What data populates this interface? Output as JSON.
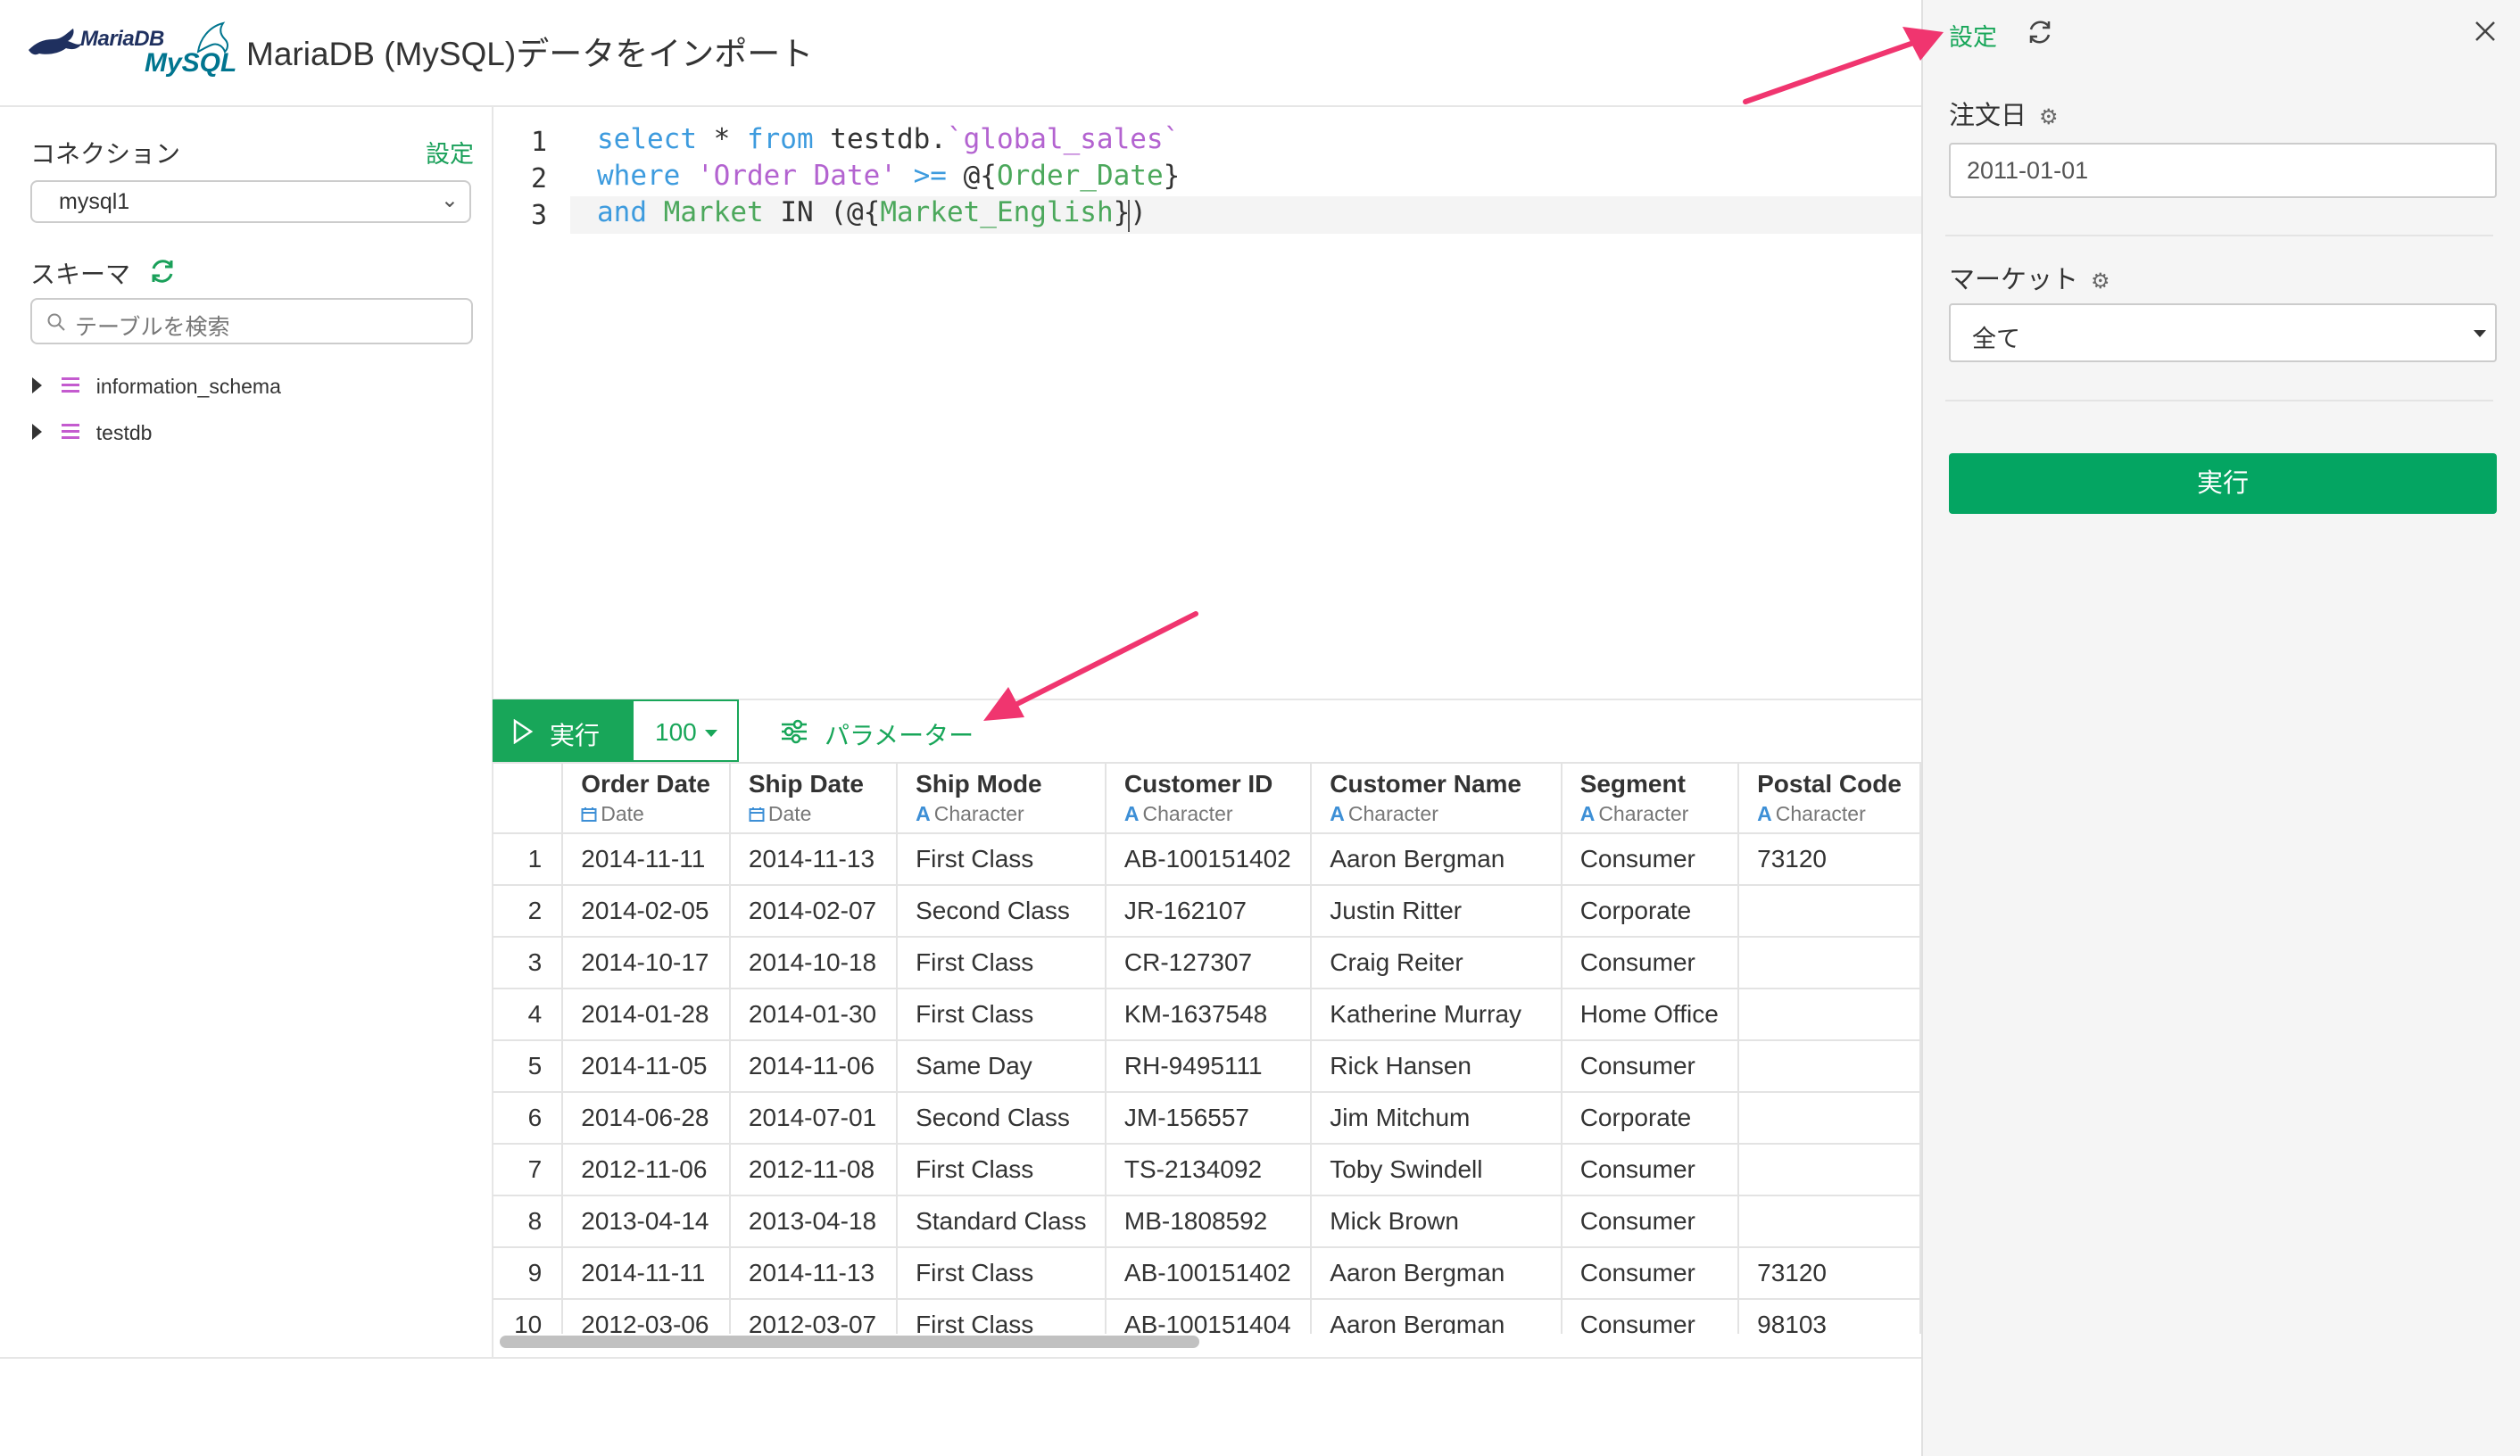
{
  "app": {
    "logo_maria": "MariaDB",
    "logo_mysql": "MySQL",
    "title": "MariaDB (MySQL)データをインポート"
  },
  "sidebar": {
    "connection_label": "コネクション",
    "settings_link": "設定",
    "connection_value": "mysql1",
    "schema_label": "スキーマ",
    "search_placeholder": "テーブルを検索",
    "databases": [
      "information_schema",
      "testdb"
    ]
  },
  "editor": {
    "line_numbers": [
      "1",
      "2",
      "3"
    ],
    "lines": [
      [
        {
          "t": "select",
          "c": "kw"
        },
        {
          "t": " * ",
          "c": "pl"
        },
        {
          "t": "from",
          "c": "kw"
        },
        {
          "t": " testdb.",
          "c": "pl"
        },
        {
          "t": "`global_sales`",
          "c": "str"
        }
      ],
      [
        {
          "t": "where",
          "c": "kw"
        },
        {
          "t": " ",
          "c": "pl"
        },
        {
          "t": "'Order Date'",
          "c": "str"
        },
        {
          "t": " ",
          "c": "pl"
        },
        {
          "t": ">=",
          "c": "kw"
        },
        {
          "t": " @{",
          "c": "pl"
        },
        {
          "t": "Order_Date",
          "c": "id"
        },
        {
          "t": "}",
          "c": "pl"
        }
      ],
      [
        {
          "t": "and",
          "c": "kw"
        },
        {
          "t": " ",
          "c": "pl"
        },
        {
          "t": "Market",
          "c": "id"
        },
        {
          "t": " IN (@{",
          "c": "pl"
        },
        {
          "t": "Market_English",
          "c": "id"
        },
        {
          "t": "})",
          "c": "pl"
        }
      ]
    ]
  },
  "toolbar": {
    "run_label": "実行",
    "limit_value": "100",
    "params_label": "パラメーター"
  },
  "table": {
    "columns": [
      {
        "name": "Order Date",
        "type": "Date",
        "type_icon": "calendar-icon"
      },
      {
        "name": "Ship Date",
        "type": "Date",
        "type_icon": "calendar-icon"
      },
      {
        "name": "Ship Mode",
        "type": "Character",
        "type_icon": "A"
      },
      {
        "name": "Customer ID",
        "type": "Character",
        "type_icon": "A"
      },
      {
        "name": "Customer Name",
        "type": "Character",
        "type_icon": "A"
      },
      {
        "name": "Segment",
        "type": "Character",
        "type_icon": "A"
      },
      {
        "name": "Postal Code",
        "type": "Character",
        "type_icon": "A"
      }
    ],
    "rows": [
      [
        "1",
        "2014-11-11",
        "2014-11-13",
        "First Class",
        "AB-100151402",
        "Aaron Bergman",
        "Consumer",
        "73120"
      ],
      [
        "2",
        "2014-02-05",
        "2014-02-07",
        "Second Class",
        "JR-162107",
        "Justin Ritter",
        "Corporate",
        ""
      ],
      [
        "3",
        "2014-10-17",
        "2014-10-18",
        "First Class",
        "CR-127307",
        "Craig Reiter",
        "Consumer",
        ""
      ],
      [
        "4",
        "2014-01-28",
        "2014-01-30",
        "First Class",
        "KM-1637548",
        "Katherine Murray",
        "Home Office",
        ""
      ],
      [
        "5",
        "2014-11-05",
        "2014-11-06",
        "Same Day",
        "RH-9495111",
        "Rick Hansen",
        "Consumer",
        ""
      ],
      [
        "6",
        "2014-06-28",
        "2014-07-01",
        "Second Class",
        "JM-156557",
        "Jim Mitchum",
        "Corporate",
        ""
      ],
      [
        "7",
        "2012-11-06",
        "2012-11-08",
        "First Class",
        "TS-2134092",
        "Toby Swindell",
        "Consumer",
        ""
      ],
      [
        "8",
        "2013-04-14",
        "2013-04-18",
        "Standard Class",
        "MB-1808592",
        "Mick Brown",
        "Consumer",
        ""
      ],
      [
        "9",
        "2014-11-11",
        "2014-11-13",
        "First Class",
        "AB-100151402",
        "Aaron Bergman",
        "Consumer",
        "73120"
      ],
      [
        "10",
        "2012-03-06",
        "2012-03-07",
        "First Class",
        "AB-100151404",
        "Aaron Bergman",
        "Consumer",
        "98103"
      ]
    ]
  },
  "right_panel": {
    "settings_label": "設定",
    "order_date_label": "注文日",
    "order_date_value": "2011-01-01",
    "market_label": "マーケット",
    "market_value": "全て",
    "execute_label": "実行"
  },
  "colors": {
    "accent_green": "#18a659",
    "execute_green": "#04a562",
    "annotation_arrow": "#f0356f",
    "keyword_blue": "#3d9bde",
    "string_purple": "#b363d0",
    "identifier_green": "#4ca85c"
  }
}
